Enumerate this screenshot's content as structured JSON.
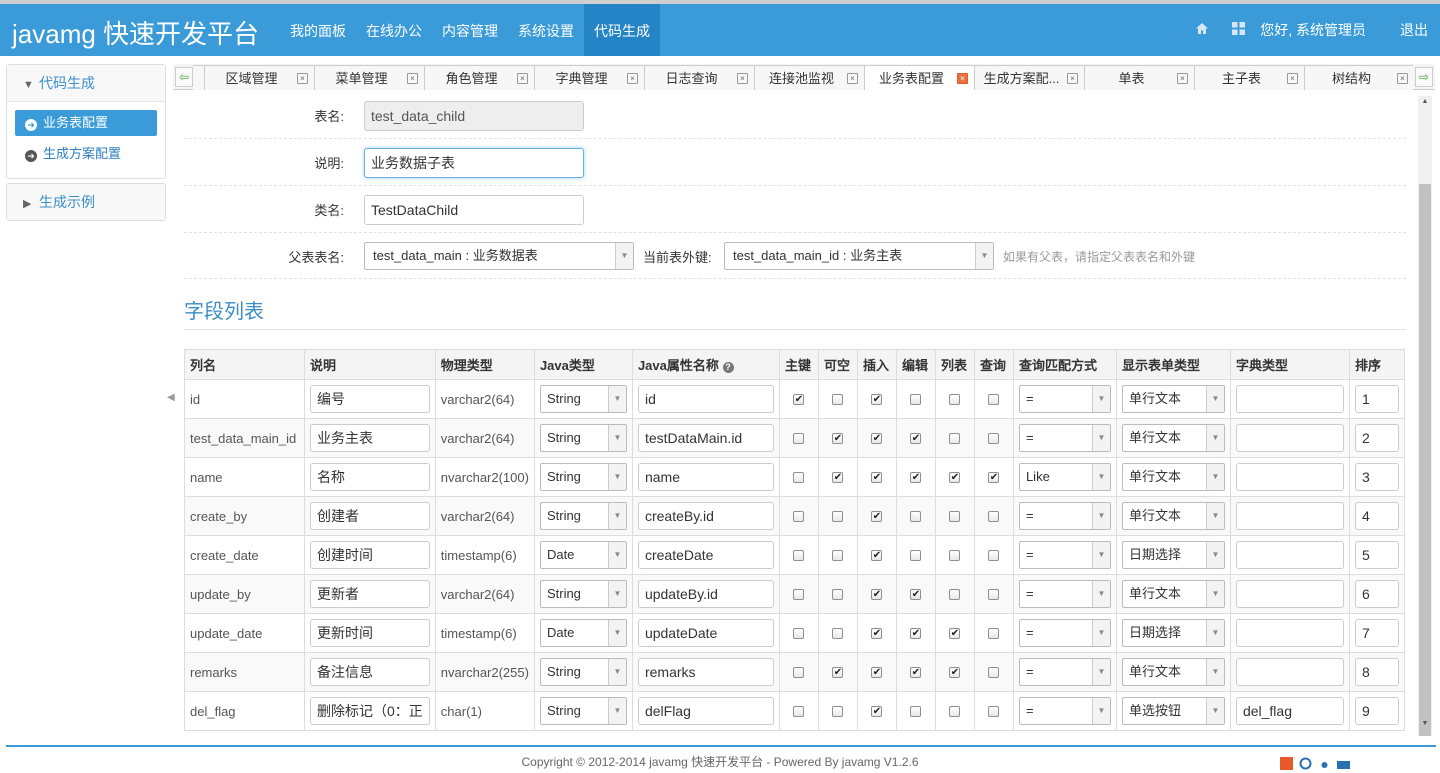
{
  "header": {
    "brand": "javamg 快速开发平台",
    "nav": [
      "我的面板",
      "在线办公",
      "内容管理",
      "系统设置",
      "代码生成"
    ],
    "active_nav": 4,
    "greeting": "您好, 系统管理员",
    "logout": "退出"
  },
  "sidebar": {
    "group1": "代码生成",
    "items": [
      "业务表配置",
      "生成方案配置"
    ],
    "group2": "生成示例"
  },
  "tabs": [
    "区域管理",
    "菜单管理",
    "角色管理",
    "字典管理",
    "日志查询",
    "连接池监视",
    "业务表配置",
    "生成方案配...",
    "单表",
    "主子表",
    "树结构"
  ],
  "form": {
    "table_name_label": "表名:",
    "table_name": "test_data_child",
    "desc_label": "说明:",
    "desc": "业务数据子表",
    "class_label": "类名:",
    "class_name": "TestDataChild",
    "parent_label": "父表表名:",
    "parent_table": "test_data_main : 业务数据表",
    "fk_label": "当前表外键:",
    "fk": "test_data_main_id : 业务主表",
    "hint": "如果有父表，请指定父表表名和外键"
  },
  "section_title": "字段列表",
  "table": {
    "headers": [
      "列名",
      "说明",
      "物理类型",
      "Java类型",
      "Java属性名称",
      "主键",
      "可空",
      "插入",
      "编辑",
      "列表",
      "查询",
      "查询匹配方式",
      "显示表单类型",
      "字典类型",
      "排序"
    ],
    "rows": [
      {
        "col": "id",
        "desc": "编号",
        "phys": "varchar2(64)",
        "jtype": "String",
        "jprop": "id",
        "pk": true,
        "nullable": false,
        "insert": true,
        "edit": false,
        "list": false,
        "query": false,
        "match": "=",
        "form": "单行文本",
        "dict": "",
        "sort": "1"
      },
      {
        "col": "test_data_main_id",
        "desc": "业务主表",
        "phys": "varchar2(64)",
        "jtype": "String",
        "jprop": "testDataMain.id",
        "pk": false,
        "nullable": true,
        "insert": true,
        "edit": true,
        "list": false,
        "query": false,
        "match": "=",
        "form": "单行文本",
        "dict": "",
        "sort": "2"
      },
      {
        "col": "name",
        "desc": "名称",
        "phys": "nvarchar2(100)",
        "jtype": "String",
        "jprop": "name",
        "pk": false,
        "nullable": true,
        "insert": true,
        "edit": true,
        "list": true,
        "query": true,
        "match": "Like",
        "form": "单行文本",
        "dict": "",
        "sort": "3"
      },
      {
        "col": "create_by",
        "desc": "创建者",
        "phys": "varchar2(64)",
        "jtype": "String",
        "jprop": "createBy.id",
        "pk": false,
        "nullable": false,
        "insert": true,
        "edit": false,
        "list": false,
        "query": false,
        "match": "=",
        "form": "单行文本",
        "dict": "",
        "sort": "4"
      },
      {
        "col": "create_date",
        "desc": "创建时间",
        "phys": "timestamp(6)",
        "jtype": "Date",
        "jprop": "createDate",
        "pk": false,
        "nullable": false,
        "insert": true,
        "edit": false,
        "list": false,
        "query": false,
        "match": "=",
        "form": "日期选择",
        "dict": "",
        "sort": "5"
      },
      {
        "col": "update_by",
        "desc": "更新者",
        "phys": "varchar2(64)",
        "jtype": "String",
        "jprop": "updateBy.id",
        "pk": false,
        "nullable": false,
        "insert": true,
        "edit": true,
        "list": false,
        "query": false,
        "match": "=",
        "form": "单行文本",
        "dict": "",
        "sort": "6"
      },
      {
        "col": "update_date",
        "desc": "更新时间",
        "phys": "timestamp(6)",
        "jtype": "Date",
        "jprop": "updateDate",
        "pk": false,
        "nullable": false,
        "insert": true,
        "edit": true,
        "list": true,
        "query": false,
        "match": "=",
        "form": "日期选择",
        "dict": "",
        "sort": "7"
      },
      {
        "col": "remarks",
        "desc": "备注信息",
        "phys": "nvarchar2(255)",
        "jtype": "String",
        "jprop": "remarks",
        "pk": false,
        "nullable": true,
        "insert": true,
        "edit": true,
        "list": true,
        "query": false,
        "match": "=",
        "form": "单行文本",
        "dict": "",
        "sort": "8"
      },
      {
        "col": "del_flag",
        "desc": "删除标记（0：正",
        "phys": "char(1)",
        "jtype": "String",
        "jprop": "delFlag",
        "pk": false,
        "nullable": false,
        "insert": true,
        "edit": false,
        "list": false,
        "query": false,
        "match": "=",
        "form": "单选按钮",
        "dict": "del_flag",
        "sort": "9"
      }
    ]
  },
  "footer": "Copyright © 2012-2014 javamg 快速开发平台 - Powered By javamg V1.2.6",
  "icons": {
    "home": "home-icon",
    "apps": "grid-icon",
    "help": "question-icon"
  },
  "colors": {
    "primary": "#3a9bd8",
    "active_nav": "#2484c6",
    "link": "#3a8ec9"
  }
}
